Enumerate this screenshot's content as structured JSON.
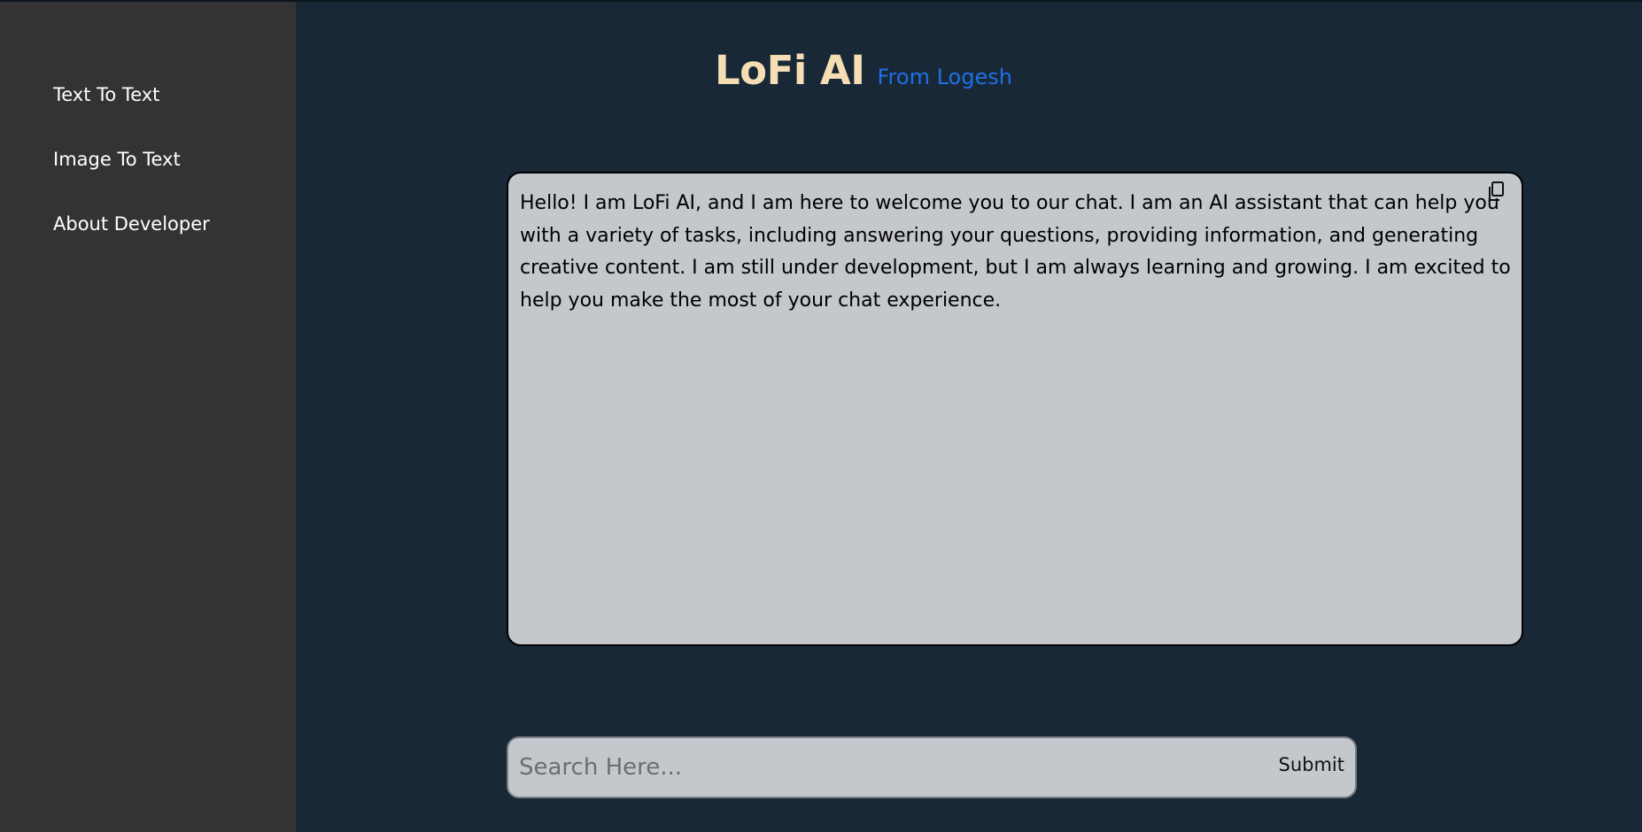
{
  "sidebar": {
    "items": [
      {
        "label": "Text To Text"
      },
      {
        "label": "Image To Text"
      },
      {
        "label": "About Developer"
      }
    ]
  },
  "header": {
    "title": "LoFi AI",
    "subtitle": "From Logesh"
  },
  "chat": {
    "message": "Hello! I am LoFi AI, and I am here to welcome you to our chat. I am an AI assistant that can help you with a variety of tasks, including answering your questions, providing information, and generating creative content. I am still under development, but I am always learning and growing. I am excited to help you make the most of your chat experience.",
    "copy_icon": "copy-icon"
  },
  "search": {
    "placeholder": "Search Here...",
    "value": "",
    "submit_label": "Submit"
  },
  "colors": {
    "sidebar_bg": "#333333",
    "main_bg": "#182836",
    "title": "#f5deb3",
    "subtitle": "#1f6fe6",
    "panel_bg": "#c4c7cc"
  }
}
